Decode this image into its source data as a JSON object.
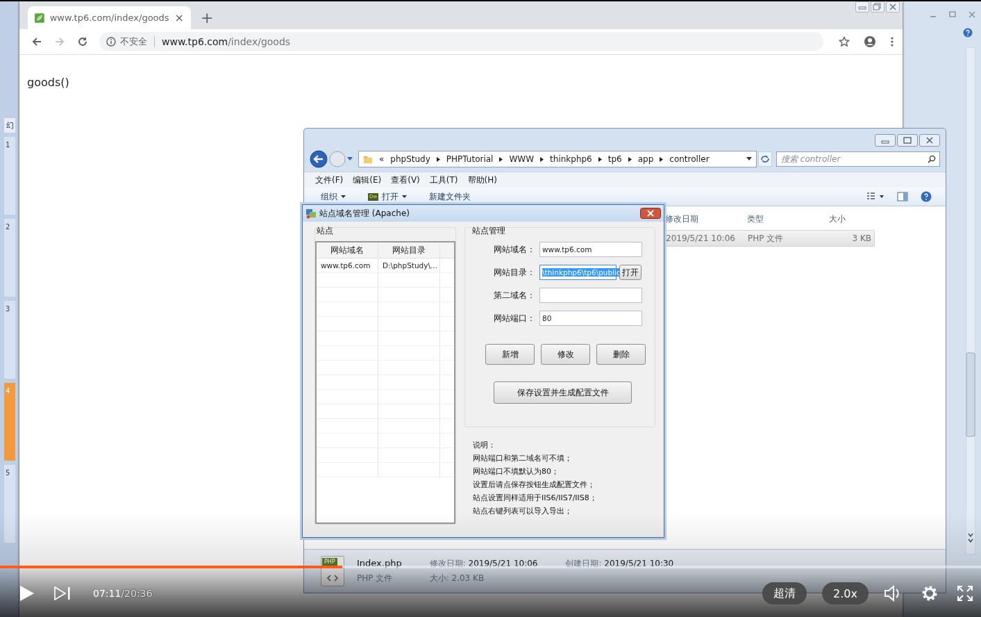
{
  "desktop": {
    "slide_pane_tab": "幻",
    "slides": [
      {
        "number": "1",
        "selected": false
      },
      {
        "number": "2",
        "selected": false
      },
      {
        "number": "3",
        "selected": false
      },
      {
        "number": "4",
        "selected": true
      },
      {
        "number": "5",
        "selected": false
      }
    ]
  },
  "browser": {
    "tab": {
      "title": "www.tp6.com/index/goods",
      "close": "×"
    },
    "new_tab": "+",
    "nav": [
      {
        "kind": "back",
        "disabled": false
      },
      {
        "kind": "forward",
        "disabled": true
      },
      {
        "kind": "reload",
        "disabled": false
      }
    ],
    "security": "不安全",
    "url_host": "www.tp6.com",
    "url_path": "/index/goods",
    "page_text": "goods()"
  },
  "explorer": {
    "path_prefix": "«",
    "breadcrumb": [
      "phpStudy",
      "PHPTutorial",
      "WWW",
      "thinkphp6",
      "tp6",
      "app",
      "controller"
    ],
    "search": {
      "placeholder": "搜索 controller"
    },
    "menu": [
      "文件(F)",
      "编辑(E)",
      "查看(V)",
      "工具(T)",
      "帮助(H)"
    ],
    "toolbar": [
      {
        "label": "组织",
        "kind": "menu"
      },
      {
        "label": "打开",
        "kind": "app",
        "icon_label": "Dw"
      },
      {
        "label": "新建文件夹",
        "kind": "plain"
      }
    ],
    "columns": [
      "修改日期",
      "类型",
      "大小"
    ],
    "rows": [
      {
        "cells": [
          "2019/5/21 10:06",
          "PHP 文件",
          "3 KB"
        ],
        "selected": true
      }
    ],
    "details": {
      "icon_label": "PHP",
      "file_name": "Index.php",
      "modified_label": "修改日期:",
      "modified": "2019/5/21 10:06",
      "created_label": "创建日期:",
      "created": "2019/5/21 10:30",
      "file_type": "PHP 文件",
      "size_label": "大小:",
      "size": "2.03 KB"
    }
  },
  "dialog": {
    "title": "站点域名管理 (Apache)",
    "sites": {
      "title": "站点",
      "columns": [
        "网站域名",
        "网站目录"
      ],
      "rows": [
        [
          "www.tp6.com",
          "D:\\phpStudy\\..."
        ]
      ]
    },
    "manage": {
      "title": "站点管理",
      "fields": [
        {
          "label": "网站域名：",
          "value": "www.tp6.com",
          "value_selected": false
        },
        {
          "label": "网站目录：",
          "value": "\\thinkphp6\\tp6\\public",
          "value_selected": true,
          "button": "打开"
        },
        {
          "label": "第二域名：",
          "value_selected": false
        },
        {
          "label": "网站端口：",
          "value": "80",
          "value_selected": false
        }
      ],
      "buttons": [
        "新增",
        "修改",
        "删除"
      ],
      "save_button": "保存设置并生成配置文件"
    },
    "notes": [
      "说明：",
      "网站端口和第二域名可不填；",
      "网站端口不填默认为80；",
      "设置后请点保存按钮生成配置文件；",
      "站点设置同样适用于IIS6/IIS7/IIS8；",
      "站点右键列表可以导入导出；"
    ]
  },
  "player": {
    "progress": {
      "level": 0.349
    },
    "current_time": "07:11",
    "duration": "/20:36",
    "quality": "超清",
    "speed": "2.0x"
  }
}
